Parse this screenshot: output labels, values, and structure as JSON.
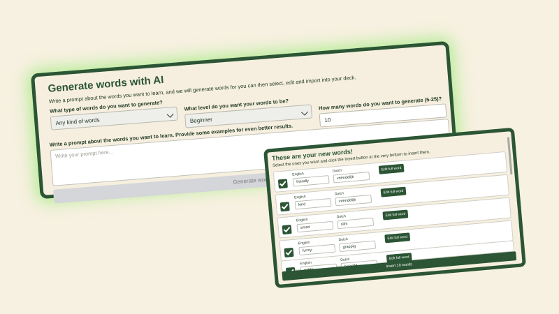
{
  "generator": {
    "title": "Generate words with AI",
    "description": "Write a prompt about the words you want to learn, and we will generate words for you can then select, edit and import into your deck.",
    "type_label": "What type of words do you want to generate?",
    "type_value": "Any kind of words",
    "level_label": "What level do you want your words to be?",
    "level_value": "Beginner",
    "count_label": "How many words do you want to generate (5-25)?",
    "count_value": "10",
    "prompt_label": "Write a prompt about the words you want to learn. Provide some examples for even better results.",
    "prompt_placeholder": "Write your prompt here...",
    "generate_button": "Generate words"
  },
  "results": {
    "title": "These are your new words!",
    "description": "Select the ones you want and click the Insert button at the very bottom to insert them.",
    "col_english": "English",
    "col_dutch": "Dutch",
    "edit_label": "Edit full word",
    "rows": [
      {
        "english": "friendly",
        "dutch": "vriendelijk",
        "checked": true
      },
      {
        "english": "kind",
        "dutch": "vriendelijk",
        "checked": true
      },
      {
        "english": "smart",
        "dutch": "slim",
        "checked": true
      },
      {
        "english": "funny",
        "dutch": "grappig",
        "checked": true
      },
      {
        "english": "polite",
        "dutch": "beleefd",
        "checked": true
      }
    ],
    "insert_button": "Insert 10 words"
  },
  "colors": {
    "accent": "#2b5534",
    "background": "#f7f1e1",
    "glow": "#84e85c"
  }
}
